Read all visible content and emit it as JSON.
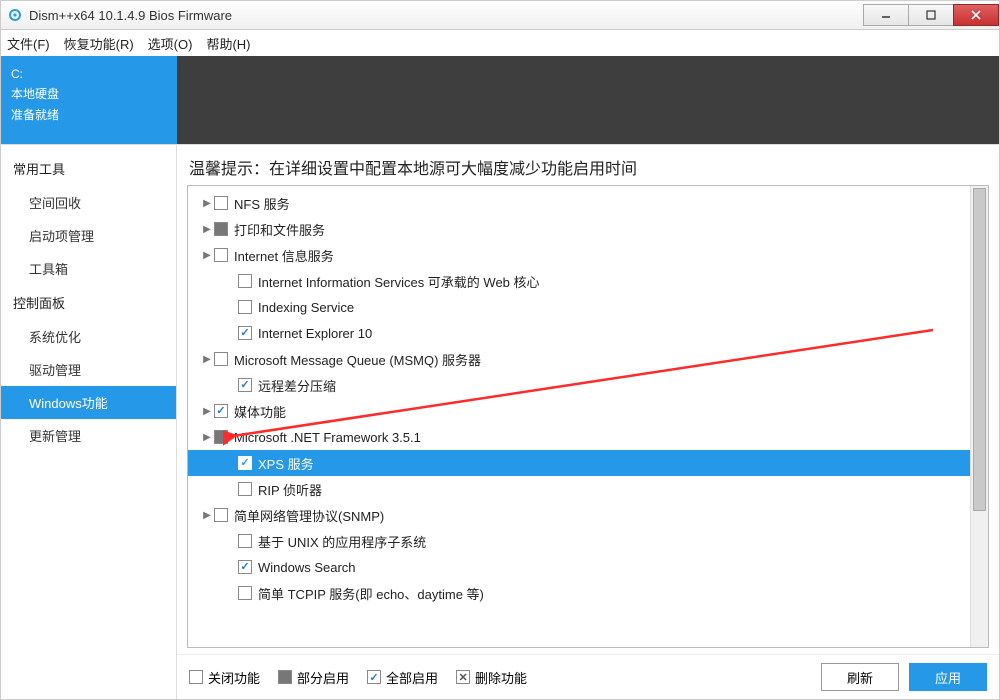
{
  "window": {
    "title": "Dism++x64 10.1.4.9 Bios Firmware"
  },
  "menu": {
    "file": "文件(F)",
    "restore": "恢复功能(R)",
    "options": "选项(O)",
    "help": "帮助(H)"
  },
  "disk": {
    "drive": "C:",
    "type": "本地硬盘",
    "status": "准备就绪"
  },
  "sidebar": {
    "s1": "常用工具",
    "i1": "空间回收",
    "i2": "启动项管理",
    "i3": "工具箱",
    "s2": "控制面板",
    "i4": "系统优化",
    "i5": "驱动管理",
    "i6": "Windows功能",
    "i7": "更新管理"
  },
  "tip": "温馨提示：在详细设置中配置本地源可大幅度减少功能启用时间",
  "tree": {
    "r0": "NFS 服务",
    "r1": "打印和文件服务",
    "r2": "Internet 信息服务",
    "r3": "Internet Information Services 可承载的 Web 核心",
    "r4": "Indexing Service",
    "r5": "Internet Explorer 10",
    "r6": "Microsoft Message Queue (MSMQ) 服务器",
    "r7": "远程差分压缩",
    "r8": "媒体功能",
    "r9": "Microsoft .NET Framework 3.5.1",
    "r10": "XPS 服务",
    "r11": "RIP 侦听器",
    "r12": "简单网络管理协议(SNMP)",
    "r13": "基于 UNIX 的应用程序子系统",
    "r14": "Windows Search",
    "r15": "简单 TCPIP 服务(即 echo、daytime 等)"
  },
  "legend": {
    "off": "关闭功能",
    "partial": "部分启用",
    "on": "全部启用",
    "del": "删除功能",
    "refresh": "刷新",
    "apply": "应用"
  }
}
